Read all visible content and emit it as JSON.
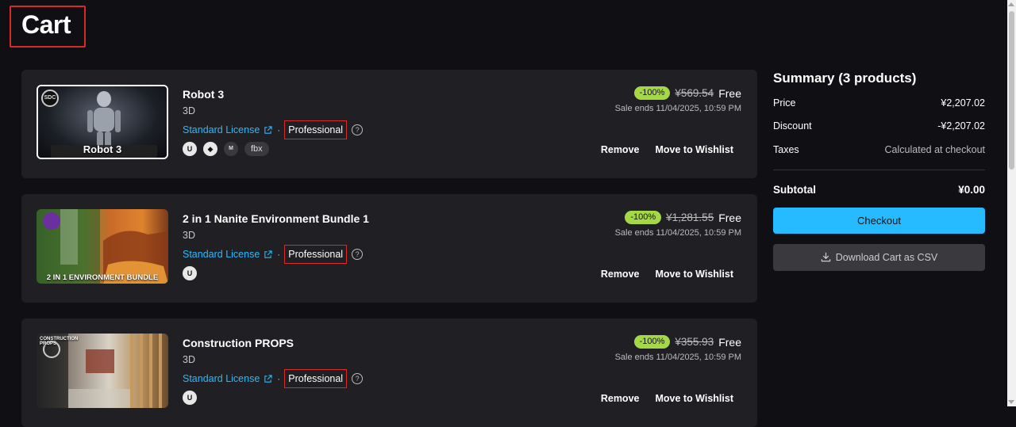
{
  "page_title": "Cart",
  "items": [
    {
      "name": "Robot 3",
      "category": "3D",
      "license_link": "Standard License",
      "license_tier": "Professional",
      "thumb_caption": "Robot 3",
      "thumb_badge": "SDC",
      "engines": [
        "unreal-engine-icon",
        "unity-icon",
        "fab-format-icon",
        "fbx"
      ],
      "engine_labels": [
        "U",
        "◆",
        "M",
        "fbx"
      ],
      "discount": "-100%",
      "original_price": "¥569.54",
      "price": "Free",
      "sale_ends": "Sale ends 11/04/2025, 10:59 PM",
      "remove_label": "Remove",
      "wishlist_label": "Move to Wishlist"
    },
    {
      "name": "2 in 1 Nanite Environment Bundle 1",
      "category": "3D",
      "license_link": "Standard License",
      "license_tier": "Professional",
      "thumb_caption": "2 IN 1 ENVIRONMENT BUNDLE",
      "engines": [
        "unreal-engine-icon"
      ],
      "engine_labels": [
        "U"
      ],
      "discount": "-100%",
      "original_price": "¥1,281.55",
      "price": "Free",
      "sale_ends": "Sale ends 11/04/2025, 10:59 PM",
      "remove_label": "Remove",
      "wishlist_label": "Move to Wishlist"
    },
    {
      "name": "Construction PROPS",
      "category": "3D",
      "license_link": "Standard License",
      "license_tier": "Professional",
      "thumb_caption": "CONSTRUCTION PROPS",
      "engines": [
        "unreal-engine-icon"
      ],
      "engine_labels": [
        "U"
      ],
      "discount": "-100%",
      "original_price": "¥355.93",
      "price": "Free",
      "sale_ends": "Sale ends 11/04/2025, 10:59 PM",
      "remove_label": "Remove",
      "wishlist_label": "Move to Wishlist"
    }
  ],
  "summary": {
    "title": "Summary (3 products)",
    "price_label": "Price",
    "price_value": "¥2,207.02",
    "discount_label": "Discount",
    "discount_value": "-¥2,207.02",
    "taxes_label": "Taxes",
    "taxes_value": "Calculated at checkout",
    "subtotal_label": "Subtotal",
    "subtotal_value": "¥0.00",
    "checkout_label": "Checkout",
    "csv_label": "Download Cart as CSV"
  },
  "colors": {
    "accent": "#26bbff",
    "discount_badge": "#a5d847",
    "highlight_border": "#d62b2b",
    "background": "#101014",
    "card": "#202024"
  }
}
